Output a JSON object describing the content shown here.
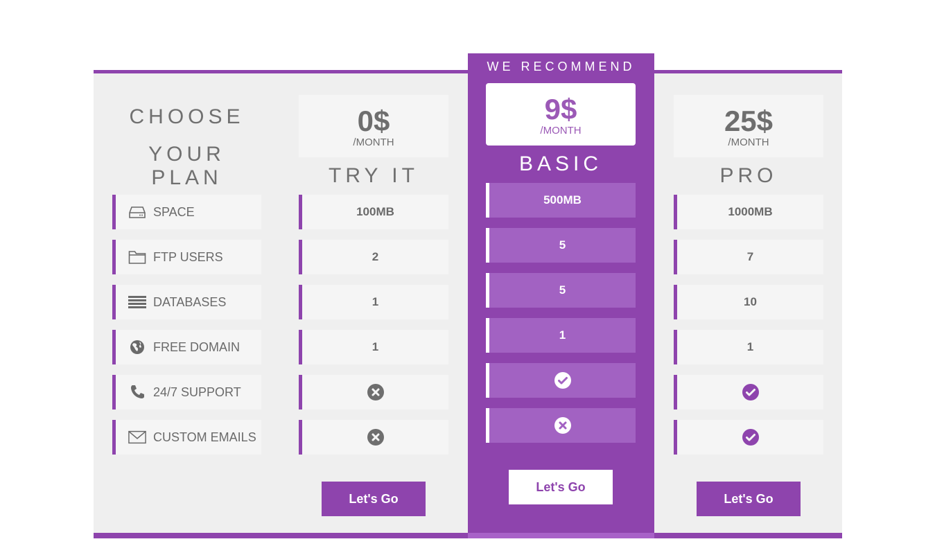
{
  "header": {
    "choose_line1": "CHOOSE",
    "choose_line2": "YOUR PLAN",
    "recommend_label": "WE RECOMMEND"
  },
  "features": [
    {
      "label": "SPACE",
      "icon": "hard-drive-icon"
    },
    {
      "label": "FTP USERS",
      "icon": "folder-icon"
    },
    {
      "label": "DATABASES",
      "icon": "database-icon"
    },
    {
      "label": "FREE DOMAIN",
      "icon": "globe-icon"
    },
    {
      "label": "24/7 SUPPORT",
      "icon": "phone-icon"
    },
    {
      "label": "CUSTOM EMAILS",
      "icon": "envelope-icon"
    }
  ],
  "plans": [
    {
      "name": "TRY IT",
      "price": "0$",
      "period": "/MONTH",
      "button": "Let's Go",
      "values": [
        "100MB",
        "2",
        "1",
        "1"
      ],
      "support": "no",
      "emails": "no"
    },
    {
      "name": "BASIC",
      "price": "9$",
      "period": "/MONTH",
      "button": "Let's Go",
      "values": [
        "500MB",
        "5",
        "5",
        "1"
      ],
      "support": "yes",
      "emails": "no"
    },
    {
      "name": "PRO",
      "price": "25$",
      "period": "/MONTH",
      "button": "Let's Go",
      "values": [
        "1000MB",
        "7",
        "10",
        "1"
      ],
      "support": "yes",
      "emails": "yes"
    }
  ],
  "colors": {
    "accent": "#8e44ad",
    "accent_light": "#a262c2",
    "panel": "#efefef",
    "cell": "#f5f5f5",
    "text": "#6a6a6a"
  }
}
